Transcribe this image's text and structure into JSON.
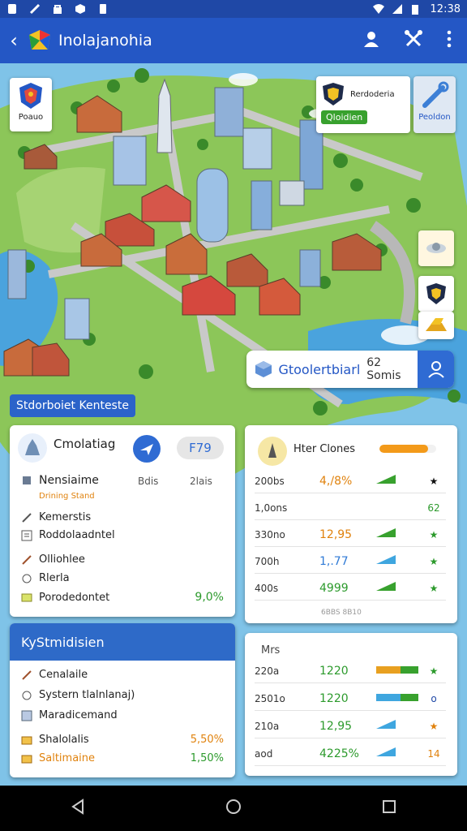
{
  "status": {
    "time": "12:38"
  },
  "appbar": {
    "title": "Inolajanohia"
  },
  "top_left_card": {
    "label": "Poauo"
  },
  "top_right_card": {
    "title": "Rerdoderia",
    "badge": "Qloidien",
    "side_label": "Peoldon"
  },
  "search": {
    "label": "Gtoolertbiarl",
    "count": "62 Somis"
  },
  "section_tag": {
    "label": "Stdorboiet Kenteste"
  },
  "card_left": {
    "title": "Cmolatiag",
    "pill": "F79",
    "header": {
      "name": "Nensiaime",
      "sub": "Drining Stand",
      "col1": "Bdis",
      "col2": "2lais"
    },
    "items": [
      {
        "icon": "pen-icon",
        "label": "Kemerstis"
      },
      {
        "icon": "list-icon",
        "label": "Roddolaadntel"
      },
      {
        "icon": "pen-icon",
        "label": "Olliohlee"
      },
      {
        "icon": "circle-icon",
        "label": "Rlerla"
      },
      {
        "icon": "folder-icon",
        "label": "Porodedontet",
        "value": "9,0%"
      }
    ]
  },
  "card_right": {
    "title": "Hter Clones",
    "progress": 0.85,
    "rows": [
      {
        "a": "200bs",
        "b": "4,/8%",
        "b_color": "orange",
        "spark": "up",
        "spark_color": "#38a12e",
        "mark": "★",
        "mark_color": "#111"
      },
      {
        "a": "1,0ons",
        "b": "",
        "b_color": "",
        "spark": "none",
        "spark_color": "#38a12e",
        "mark": "62",
        "mark_color": "#2c9a2c"
      },
      {
        "a": "330no",
        "b": "12,95",
        "b_color": "orange",
        "spark": "up",
        "spark_color": "#38a12e",
        "mark": "★",
        "mark_color": "#2c9a2c"
      },
      {
        "a": "700h",
        "b": "1,.77",
        "b_color": "blue",
        "spark": "up",
        "spark_color": "#3fa6df",
        "mark": "★",
        "mark_color": "#2c9a2c"
      },
      {
        "a": "400s",
        "b": "4999",
        "b_color": "green",
        "spark": "up",
        "spark_color": "#38a12e",
        "mark": "★",
        "mark_color": "#2c9a2c",
        "sub": "6BBS 8B10"
      }
    ]
  },
  "card_bottom_left": {
    "title": "KyStmidisien",
    "items": [
      {
        "icon": "pen-icon",
        "label": "Cenalaile"
      },
      {
        "icon": "circle-icon",
        "label": "Systern tlalnlanaj)"
      },
      {
        "icon": "grid-icon",
        "label": "Maradicemand"
      },
      {
        "icon": "folder-icon",
        "label": "Shalolalis",
        "value": "5,50%",
        "value_color": "orange"
      },
      {
        "icon": "folder-icon",
        "label": "Saltimaine",
        "value": "1,50%",
        "value_color": "green",
        "label_color": "orange"
      }
    ]
  },
  "card_bottom_right": {
    "title": "Mrs",
    "rows": [
      {
        "a": "220a",
        "b": "1220",
        "b_color": "green",
        "spark": "bar",
        "spark_color": "#e8a020",
        "mark": "★",
        "mark_color": "#2c9a2c"
      },
      {
        "a": "2501o",
        "b": "1220",
        "b_color": "green",
        "spark": "bar",
        "spark_color": "#3fa6df",
        "mark": "o",
        "mark_color": "#1f48a6"
      },
      {
        "a": "210a",
        "b": "12,95",
        "b_color": "green",
        "spark": "up",
        "spark_color": "#3fa6df",
        "mark": "★",
        "mark_color": "#e0820d"
      },
      {
        "a": "aod",
        "b": "4225%",
        "b_color": "green",
        "spark": "up",
        "spark_color": "#3fa6df",
        "mark": "14",
        "mark_color": "#e0820d"
      }
    ]
  },
  "colors": {
    "appbar": "#2457c5",
    "statusbar": "#1f48a6",
    "accent_orange": "#e8a020",
    "accent_green": "#38a12e",
    "accent_blue": "#2f6bd3"
  }
}
